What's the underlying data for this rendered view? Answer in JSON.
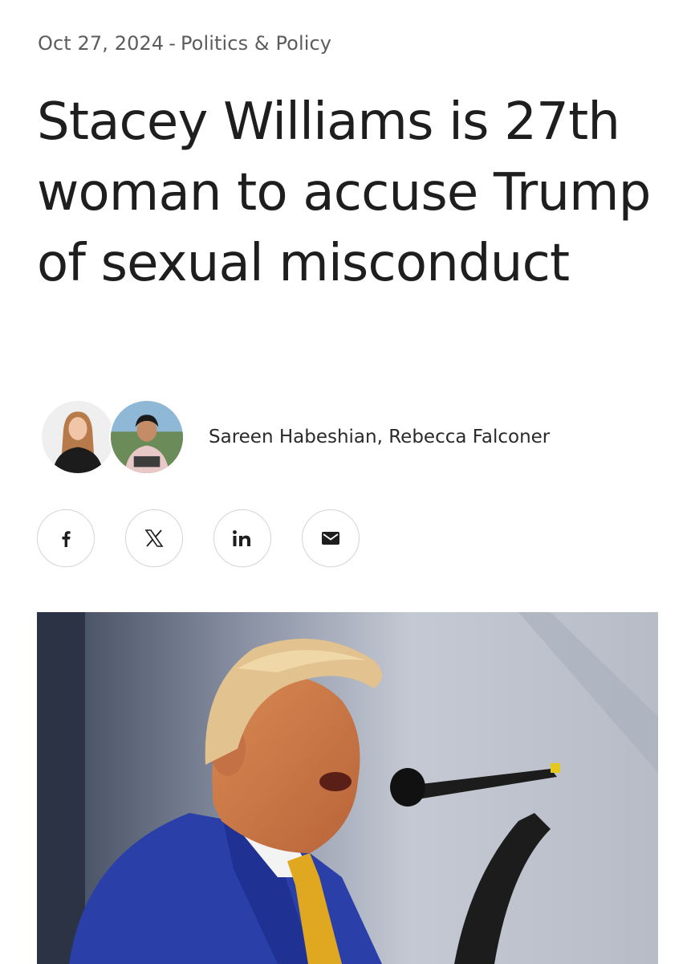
{
  "article": {
    "date": "Oct 27, 2024",
    "separator": "-",
    "category": "Politics & Policy",
    "headline": "Stacey Williams is 27th woman to accuse Trump of sexual misconduct",
    "authors": "Sareen Habeshian, Rebecca Falconer"
  },
  "share": {
    "buttons": [
      {
        "icon": "facebook-icon"
      },
      {
        "icon": "x-icon"
      },
      {
        "icon": "linkedin-icon"
      },
      {
        "icon": "email-icon"
      }
    ]
  },
  "colors": {
    "text": "#1e1e1e",
    "meta": "#5c5c5c",
    "border": "#d4d4d4",
    "suit": "#2a3fa8",
    "tie": "#e0a820"
  }
}
